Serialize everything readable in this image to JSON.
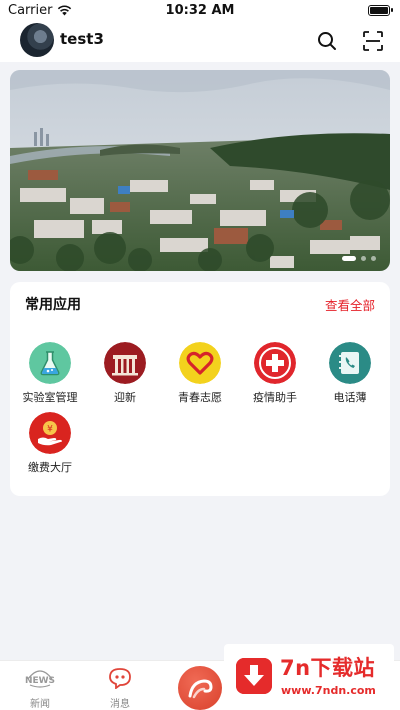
{
  "status_bar": {
    "carrier": "Carrier",
    "time": "10:32 AM"
  },
  "header": {
    "username": "test3"
  },
  "apps_section": {
    "title": "常用应用",
    "view_all": "查看全部",
    "apps": [
      {
        "label": "实验室管理",
        "icon": "lab-flask-icon",
        "color": "#5fc7a0"
      },
      {
        "label": "迎新",
        "icon": "welcome-gate-icon",
        "color": "#9c1c21"
      },
      {
        "label": "青春志愿",
        "icon": "heart-icon",
        "color": "#f3d21d"
      },
      {
        "label": "疫情助手",
        "icon": "medical-cross-icon",
        "color": "#e0262c"
      },
      {
        "label": "电话薄",
        "icon": "phone-book-icon",
        "color": "#2b8b86"
      },
      {
        "label": "缴费大厅",
        "icon": "payment-hand-icon",
        "color": "#d9241f"
      }
    ]
  },
  "tabbar": {
    "tabs": [
      {
        "label": "新闻",
        "icon": "news-icon",
        "badge": "NEWS"
      },
      {
        "label": "消息",
        "icon": "message-icon"
      }
    ]
  },
  "watermark": {
    "title": "7n下载站",
    "url": "www.7ndn.com"
  },
  "colors": {
    "accent": "#e5222a",
    "background": "#f2f3f7"
  }
}
